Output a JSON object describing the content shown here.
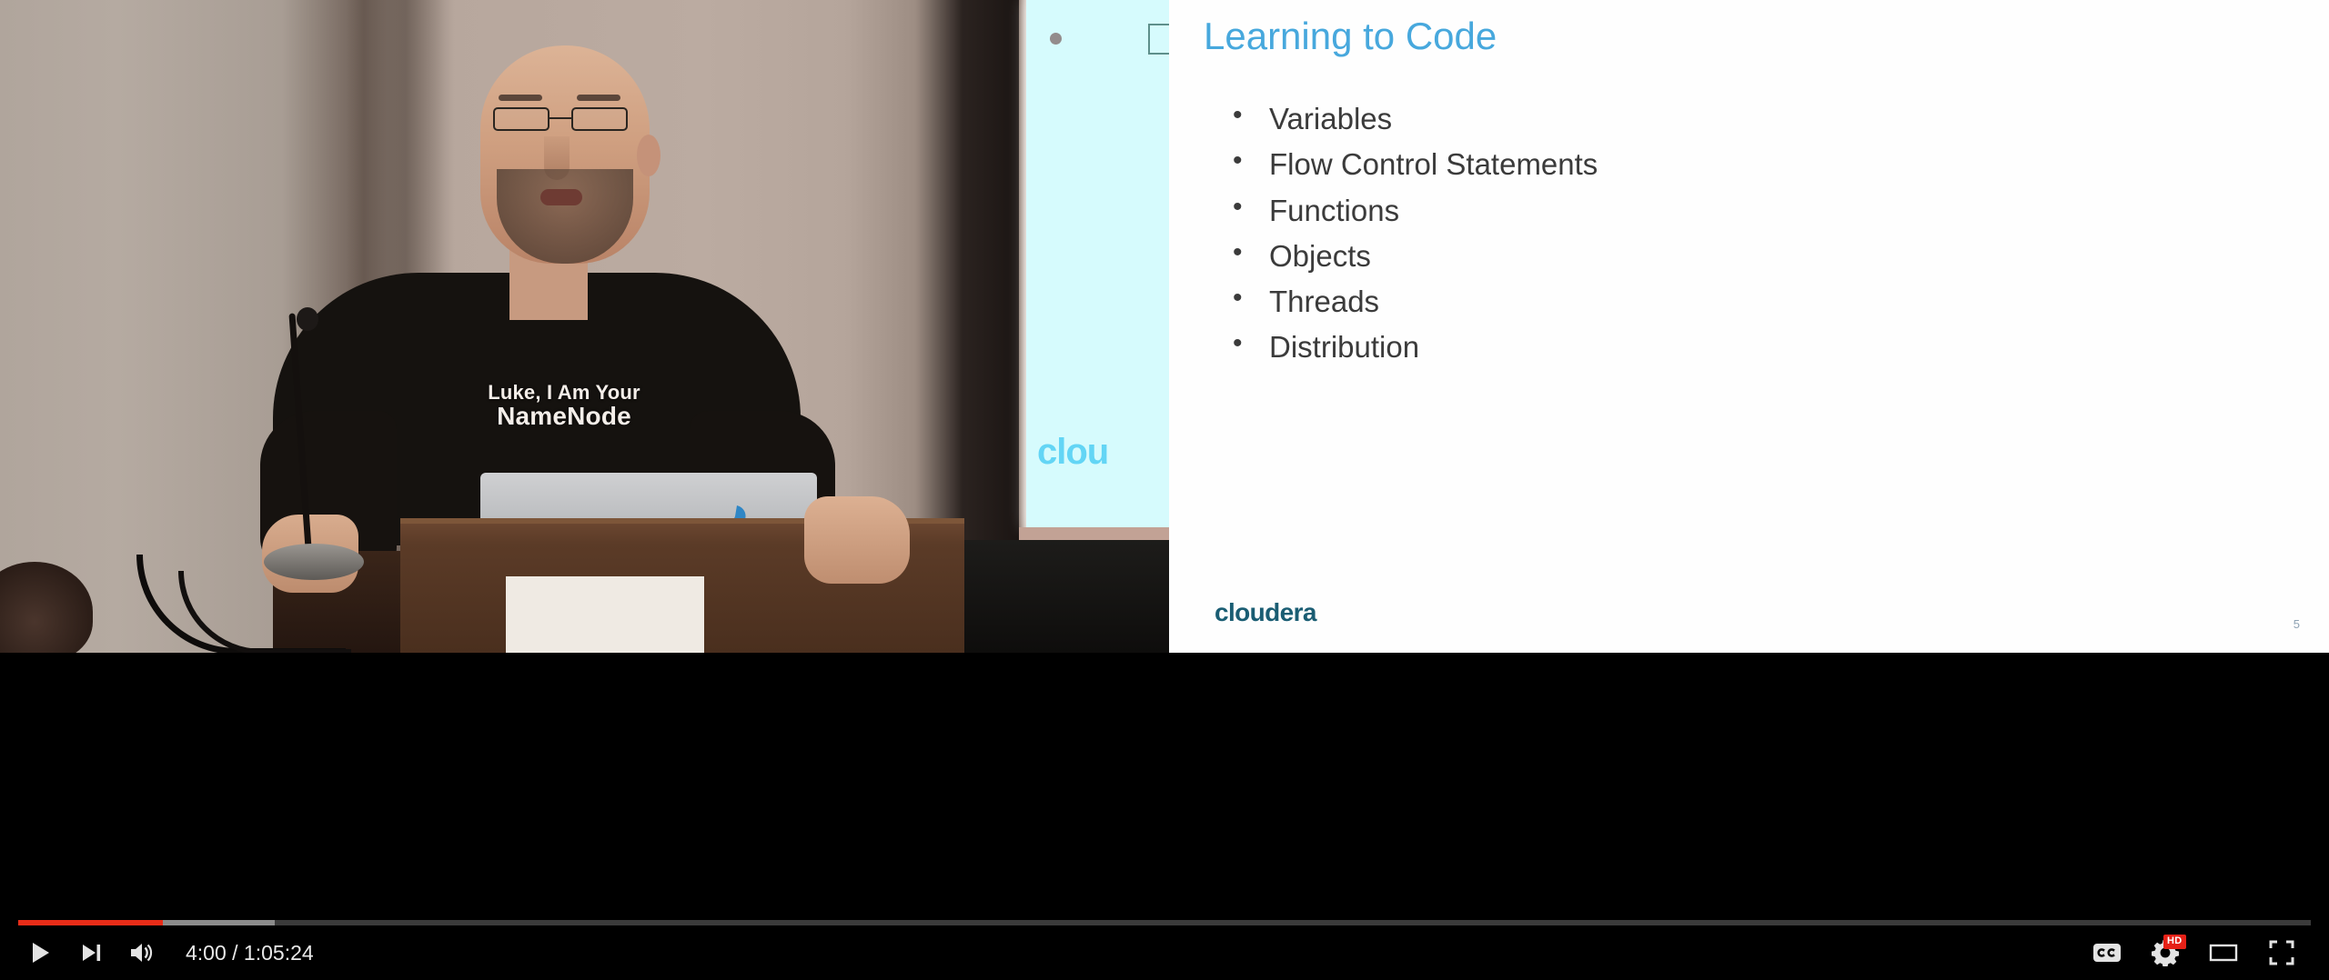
{
  "player": {
    "time_display": "4:00 / 1:05:24",
    "current_time": "4:00",
    "duration": "1:05:24",
    "progress_played_percent": 6.3,
    "progress_loaded_percent": 11.2,
    "state": "paused",
    "accent_color": "#e82c18",
    "buffered_color": "#8c8c8c",
    "track_color": "#3b3b3b",
    "controls": {
      "play": "play-button",
      "next": "next-video-button",
      "volume": "volume-button",
      "captions": "cc",
      "settings": "settings-gear",
      "quality_badge": "HD",
      "theater": "theater-mode-button",
      "fullscreen": "fullscreen-button"
    }
  },
  "slide": {
    "title": "Learning to Code",
    "title_color": "#47a8dd",
    "bullets": [
      "Variables",
      "Flow Control Statements",
      "Functions",
      "Objects",
      "Threads",
      "Distribution"
    ],
    "logo": "cloudera",
    "logo_color": "#1a5d73",
    "page_number": "5"
  },
  "video_scene": {
    "speaker_shirt_line1": "Luke, I Am Your",
    "speaker_shirt_line2": "NameNode",
    "projector_logo": "clou"
  }
}
